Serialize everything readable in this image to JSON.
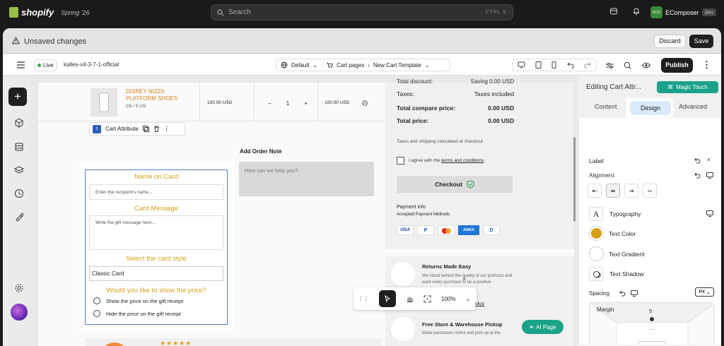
{
  "topbar": {
    "brand": "shopify",
    "season": "Spring '26",
    "search_placeholder": "Search",
    "shortcut": "CTRL K",
    "store_initials": "ECO",
    "store_name": "EComposer",
    "store_badge": "dev"
  },
  "unsaved": {
    "title": "Unsaved changes",
    "discard": "Discard",
    "save": "Save"
  },
  "toolbar": {
    "status": "Live",
    "theme": "kalles-v4-3-7-1-official",
    "device": "Default",
    "crumb1": "Cart pages",
    "crumb2": "New Cart Template",
    "publish": "Publish"
  },
  "cart": {
    "product_name": "DISNEY NIZZA PLATFORM SHOES",
    "product_variant": "C6 / 5 US",
    "price": "100.00 USD",
    "qty": "1",
    "line_total": "100.00 USD",
    "element_label": "Cart Attribute",
    "name_label": "Name on Card",
    "name_placeholder": "Enter the recipient's name...",
    "message_label": "Card Message",
    "message_placeholder": "Write the gift message here...",
    "style_label": "Select the card style",
    "style_value": "Classic Card",
    "price_question": "Would you like to show the price?",
    "option1": "Show the price on the gift receipt",
    "option2": "Hide the price on the gift receipt",
    "note_title": "Add Order Note",
    "note_placeholder": "How can we help you?"
  },
  "summary": {
    "discount_label": "Total discount:",
    "discount_value": "Saving 0.00 USD",
    "taxes_label": "Taxes:",
    "taxes_value": "Taxes included",
    "compare_label": "Total compare price:",
    "compare_value": "0.00 USD",
    "total_label": "Total price:",
    "total_value": "0.00 USD",
    "shipping_note": "Taxes and shipping calculated at checkout",
    "agree_prefix": "I agree with the ",
    "agree_link": "terms and conditions",
    "agree_suffix": ".",
    "checkout": "Checkout",
    "payment_title": "Payment info",
    "payment_sub": "Accepted Payment Methods",
    "cards": [
      "VISA",
      "P",
      "MC",
      "AMEX",
      "D"
    ]
  },
  "features": [
    {
      "title": "Returns Made Easy",
      "text": "We stand behind the quality of our products and want every purchase to be a positive"
    },
    {
      "title": "Free Store & Warehouse Pickup",
      "text": "Make purchases online and pick up at the"
    }
  ],
  "review": {
    "stars": "★★★★★"
  },
  "float": {
    "zoom": "100%",
    "policy": "olicy",
    "ai": "AI Page"
  },
  "panel": {
    "title": "Editing Cart Attr...",
    "magic": "Magic Touch",
    "tabs": [
      "Content",
      "Design",
      "Advanced"
    ],
    "label": "Label",
    "alignment": "Alignment",
    "typography": "Typography",
    "text_color": "Text Color",
    "text_gradient": "Text Gradient",
    "text_shadow": "Text Shadow",
    "spacing": "Spacing",
    "unit": "PX",
    "margin": "Margin",
    "margin_top": "5",
    "dash": "—"
  },
  "colors": {
    "gold": "#d4a017",
    "accent_teal": "#1aa38a",
    "selection": "#4a7fd6"
  }
}
